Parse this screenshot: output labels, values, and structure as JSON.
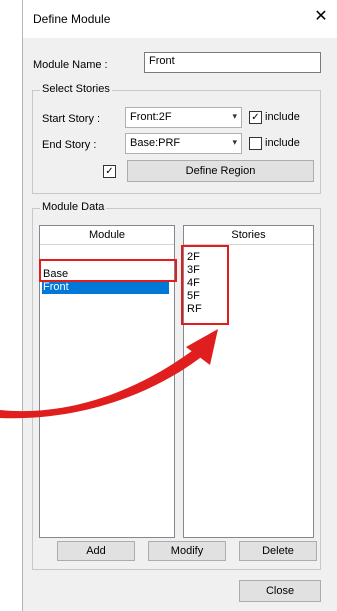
{
  "dialog": {
    "title": "Define Module",
    "close_glyph": "✕"
  },
  "module_name": {
    "label": "Module Name :",
    "value": "Front"
  },
  "select_stories": {
    "caption": "Select Stories",
    "start_label": "Start Story :",
    "start_value": "Front:2F",
    "start_include_checked": true,
    "start_include_label": "include",
    "end_label": "End Story :",
    "end_value": "Base:PRF",
    "end_include_checked": false,
    "end_include_label": "include",
    "region_checked": true,
    "define_region_label": "Define Region"
  },
  "module_data": {
    "caption": "Module Data",
    "module_header": "Module",
    "stories_header": "Stories",
    "modules": [
      "Base",
      "Front"
    ],
    "selected_module": "Front",
    "stories": [
      "2F",
      "3F",
      "4F",
      "5F",
      "RF"
    ]
  },
  "buttons": {
    "add": "Add",
    "modify": "Modify",
    "delete": "Delete",
    "close": "Close"
  },
  "icons": {
    "check_glyph": "✓",
    "dropdown_glyph": "▾"
  },
  "annotation": {
    "color": "#e01e1e"
  }
}
